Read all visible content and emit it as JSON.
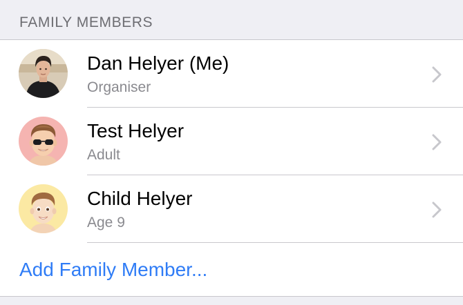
{
  "section": {
    "title": "FAMILY MEMBERS"
  },
  "members": [
    {
      "name": "Dan Helyer (Me)",
      "role": "Organiser",
      "avatar": "photo-avatar"
    },
    {
      "name": "Test Helyer",
      "role": "Adult",
      "avatar": "memoji-sunglasses-avatar"
    },
    {
      "name": "Child Helyer",
      "role": "Age 9",
      "avatar": "memoji-child-avatar"
    }
  ],
  "actions": {
    "add_member": "Add Family Member..."
  },
  "colors": {
    "background": "#efeff4",
    "separator": "#c8c7cc",
    "link": "#2f7cf6",
    "secondary_text": "#8a8a8f",
    "chevron": "#c7c7cc",
    "avatar_adult_bg": "#f5b4b1",
    "avatar_child_bg": "#fbe9a3"
  },
  "icons": {
    "chevron": "chevron-right-icon"
  }
}
